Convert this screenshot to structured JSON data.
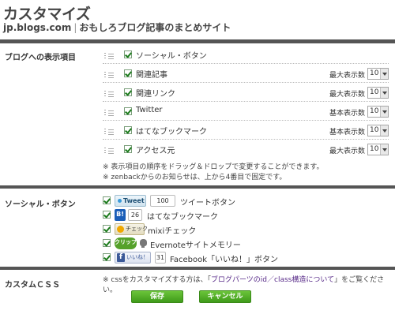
{
  "header": {
    "title": "カスタマイズ",
    "site": "jp.blogs.com",
    "separator": "|",
    "tagline": "おもしろブログ記事のまとめサイト"
  },
  "display_section": {
    "label": "ブログへの表示項目",
    "items": [
      {
        "label": "ソーシャル・ボタン",
        "checked": true,
        "right_label": "",
        "select_value": ""
      },
      {
        "label": "関連記事",
        "checked": true,
        "right_label": "最大表示数",
        "select_value": "10"
      },
      {
        "label": "関連リンク",
        "checked": true,
        "right_label": "最大表示数",
        "select_value": "10"
      },
      {
        "label": "Twitter",
        "checked": true,
        "right_label": "基本表示数",
        "select_value": "10"
      },
      {
        "label": "はてなブックマーク",
        "checked": true,
        "right_label": "基本表示数",
        "select_value": "10"
      },
      {
        "label": "アクセス元",
        "checked": true,
        "right_label": "最大表示数",
        "select_value": "10"
      }
    ],
    "notes": [
      "※ 表示項目の順序をドラッグ＆ドロップで変更することができます。",
      "※ zenbackからのお知らせは、上から4番目で固定です。"
    ]
  },
  "social_section": {
    "label": "ソーシャル・ボタン",
    "items": [
      {
        "button_text": "Tweet",
        "count": "100",
        "label": "ツイートボタン",
        "checked": true
      },
      {
        "button_text": "B!",
        "count": "26",
        "label": "はてなブックマーク",
        "checked": true
      },
      {
        "button_text": "チェック",
        "count": "",
        "label": "mixiチェック",
        "checked": true
      },
      {
        "button_text": "クリップ",
        "count": "",
        "label": "Evernoteサイトメモリー",
        "checked": true
      },
      {
        "button_text": "いいね！",
        "count": "31",
        "label": "Facebook「いいね！」ボタン",
        "checked": true
      }
    ]
  },
  "css_section": {
    "label": "カスタムＣＳＳ",
    "note_prefix": "※ cssをカスタマイズする方は、「",
    "note_link": "ブログパーツのid／class構造について",
    "note_suffix": "」をご覧ください。"
  },
  "actions": {
    "save_label": "保存",
    "cancel_label": "キャンセル"
  },
  "colors": {
    "rule": "#555555",
    "check": "#1a7a1a",
    "button_green": "#4caf22",
    "link": "#5a2d8a"
  }
}
